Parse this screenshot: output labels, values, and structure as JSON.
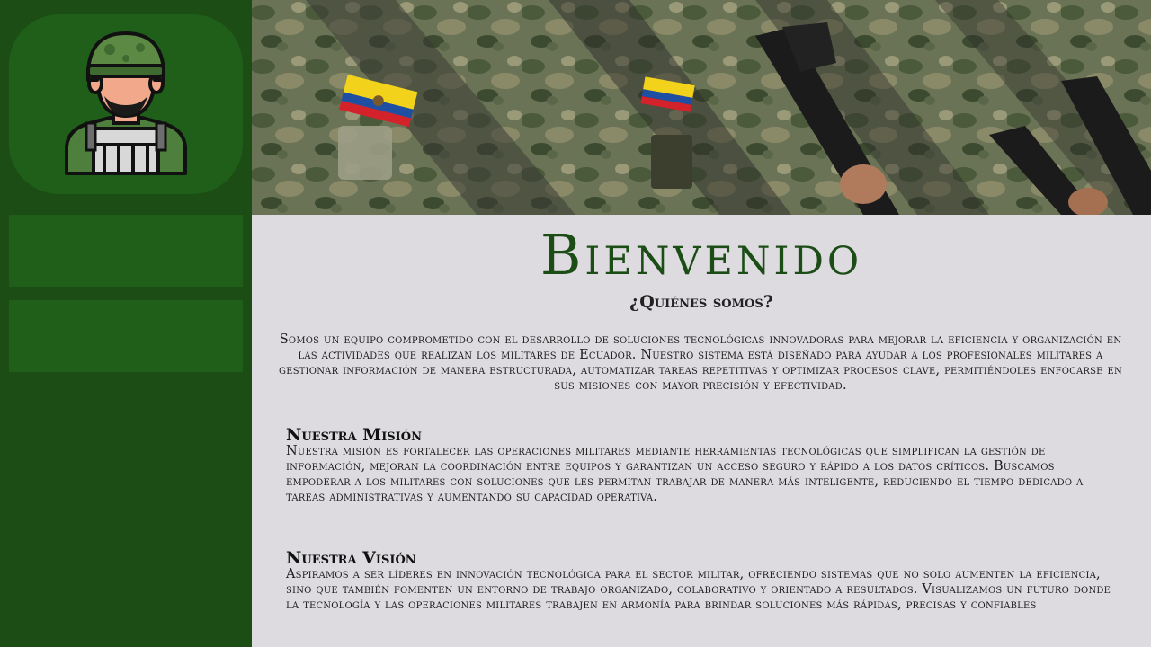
{
  "sidebar": {
    "avatar_icon": "soldier-avatar-icon",
    "accent": "#1b4d14",
    "card_color": "#1f5f1a",
    "buttons": [
      {
        "label": ""
      },
      {
        "label": ""
      }
    ]
  },
  "hero": {
    "image": "soldiers-uniform-ecuador-flag-patch",
    "flag_colors": [
      "#f2d21a",
      "#1e4fa3",
      "#d3222a"
    ]
  },
  "main": {
    "title": "Bienvenido",
    "subtitle": "¿Quiénes somos?",
    "intro": "Somos un equipo comprometido con el desarrollo de soluciones tecnológicas innovadoras para mejorar la eficiencia y organización en las actividades que realizan los militares de Ecuador. Nuestro sistema está diseñado para ayudar a los profesionales militares a gestionar información de manera estructurada, automatizar tareas repetitivas y optimizar procesos clave, permitiéndoles enfocarse en sus misiones con mayor precisión y efectividad.",
    "mission": {
      "title": "Nuestra Misión",
      "body": "Nuestra misión es fortalecer las operaciones militares mediante herramientas tecnológicas que simplifican la gestión de información, mejoran la coordinación entre equipos y garantizan un acceso seguro y rápido a los datos críticos. Buscamos empoderar a los militares con soluciones que les permitan trabajar de manera más inteligente, reduciendo el tiempo dedicado a tareas administrativas y aumentando su capacidad operativa."
    },
    "vision": {
      "title": "Nuestra Visión",
      "body": "Aspiramos a ser líderes en innovación tecnológica para el sector militar, ofreciendo sistemas que no solo aumenten la eficiencia, sino que también fomenten un entorno de trabajo organizado, colaborativo y orientado a resultados. Visualizamos un futuro donde la tecnología y las operaciones militares trabajen en armonía para brindar soluciones más rápidas, precisas y confiables"
    }
  }
}
